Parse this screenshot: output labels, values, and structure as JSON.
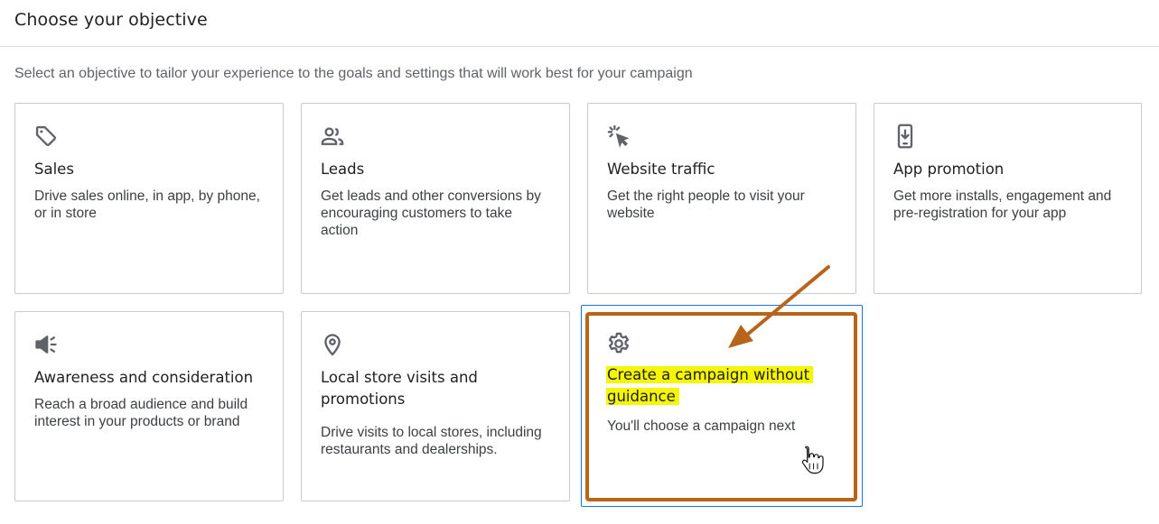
{
  "header": {
    "title": "Choose your objective"
  },
  "subtitle": "Select an objective to tailor your experience to the goals and settings that will work best for your campaign",
  "cards": [
    {
      "icon": "tag-icon",
      "title": "Sales",
      "desc": "Drive sales online, in app, by phone, or in store"
    },
    {
      "icon": "people-icon",
      "title": "Leads",
      "desc": "Get leads and other conversions by encouraging customers to take action"
    },
    {
      "icon": "cursor-click-icon",
      "title": "Website traffic",
      "desc": "Get the right people to visit your website"
    },
    {
      "icon": "phone-download-icon",
      "title": "App promotion",
      "desc": "Get more installs, engagement and pre-registration for your app"
    },
    {
      "icon": "megaphone-icon",
      "title": "Awareness and consideration",
      "desc": "Reach a broad audience and build interest in your products or brand"
    },
    {
      "icon": "location-pin-icon",
      "title": "Local store visits and promotions",
      "desc": "Drive visits to local stores, including restaurants and dealerships."
    },
    {
      "icon": "gear-icon",
      "title_line1": "Create a campaign without",
      "title_line2": "guidance",
      "desc": "You'll choose a campaign next"
    }
  ],
  "colors": {
    "selected_border": "#1a73e8",
    "annotation": "#b8651c",
    "highlight": "#f6f600"
  }
}
